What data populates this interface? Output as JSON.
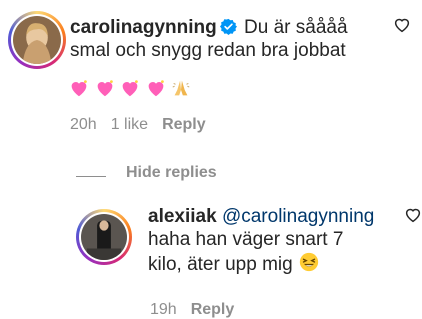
{
  "comment": {
    "username": "carolinagynning",
    "text_line1": "Du är såååå",
    "text_line2": "smal och snygg redan bra jobbat",
    "emojis": [
      "heart-icon",
      "heart-icon",
      "heart-icon",
      "heart-icon",
      "folded-hands-icon"
    ],
    "time": "20h",
    "likes": "1 like",
    "reply_label": "Reply"
  },
  "hide_replies_label": "Hide replies",
  "reply": {
    "username": "alexiiak",
    "mention": "@carolinagynning",
    "text_line2": "haha han väger snart 7",
    "text_line3": "kilo, äter upp mig",
    "emoji": "laughing-icon",
    "time": "19h",
    "reply_label": "Reply"
  },
  "colors": {
    "text": "#262626",
    "meta": "#8e8e8e",
    "verified": "#0095f6",
    "mention": "#00376b"
  }
}
